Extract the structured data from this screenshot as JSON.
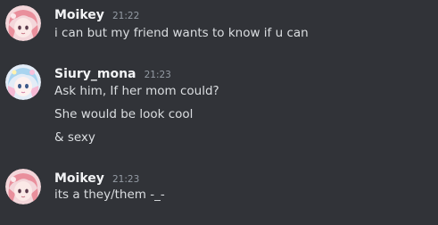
{
  "messages": [
    {
      "username": "Moikey",
      "timestamp": "21:22",
      "avatar": "pink-haired-anime-avatar-icon",
      "lines": [
        "i can but my friend wants to know if u can"
      ]
    },
    {
      "username": "Siury_mona",
      "timestamp": "21:23",
      "avatar": "pastel-anime-avatar-icon",
      "lines": [
        "Ask him, If her mom could?",
        "She would be look cool",
        "& sexy"
      ]
    },
    {
      "username": "Moikey",
      "timestamp": "21:23",
      "avatar": "pink-haired-anime-avatar-icon",
      "lines": [
        "its a they/them -_-"
      ]
    }
  ],
  "colors": {
    "background": "#313338",
    "username": "#f2f3f5",
    "message_text": "#dbdee1",
    "timestamp": "#949ba4"
  }
}
